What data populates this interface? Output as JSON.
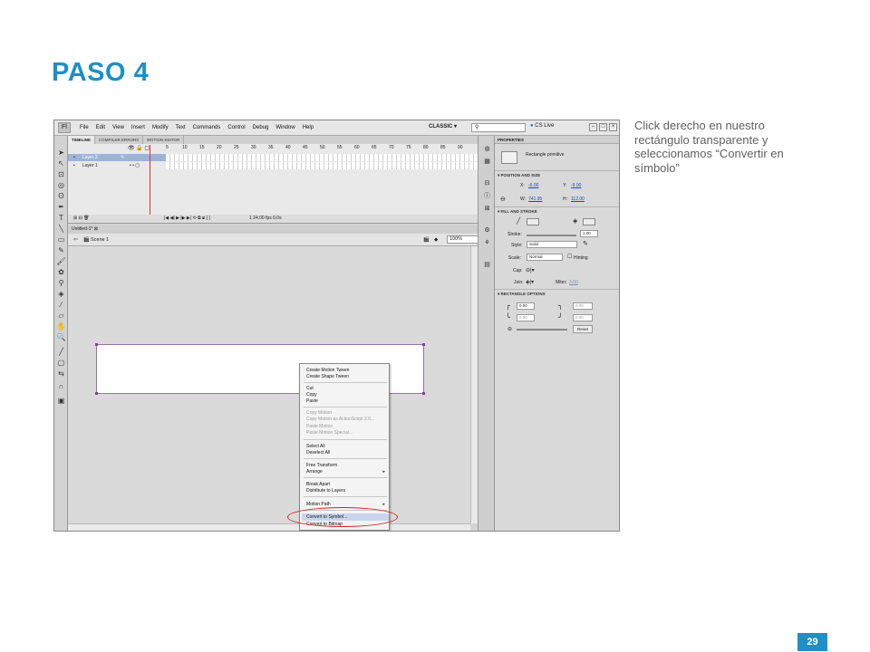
{
  "slide": {
    "title": "PASO 4",
    "caption": "Click derecho en nuestro rectángulo transparente  y seleccionamos “Convertir en símbolo”",
    "page_number": "29",
    "accent_color": "#1f8fc6"
  },
  "app": {
    "logo": "Fl",
    "menus": [
      "File",
      "Edit",
      "View",
      "Insert",
      "Modify",
      "Text",
      "Commands",
      "Control",
      "Debug",
      "Window",
      "Help"
    ],
    "workspace": "CLASSIC ▾",
    "search_placeholder": "",
    "cs_live": "CS Live",
    "timeline": {
      "tabs": [
        "TIMELINE",
        "COMPILER ERRORS",
        "MOTION EDITOR"
      ],
      "frame_numbers": [
        "5",
        "10",
        "15",
        "20",
        "25",
        "30",
        "35",
        "40",
        "45",
        "50",
        "55",
        "60",
        "65",
        "70",
        "75",
        "80",
        "85",
        "90"
      ],
      "layers": [
        "Layer 2",
        "Layer 1"
      ],
      "status": "1   24.00 fps   0.0s"
    },
    "document": {
      "tab": "Untitled-1* ⊠",
      "scene": "Scene 1",
      "zoom": "100%"
    },
    "context_menu": {
      "items": [
        {
          "label": "Create Motion Tween",
          "dim": false
        },
        {
          "label": "Create Shape Tween",
          "dim": false
        },
        {
          "label": "Cut",
          "dim": false
        },
        {
          "label": "Copy",
          "dim": false
        },
        {
          "label": "Paste",
          "dim": false
        },
        {
          "label": "Copy Motion",
          "dim": true
        },
        {
          "label": "Copy Motion as ActionScript 3.0...",
          "dim": true
        },
        {
          "label": "Paste Motion",
          "dim": true
        },
        {
          "label": "Paste Motion Special...",
          "dim": true
        },
        {
          "label": "Select All",
          "dim": false
        },
        {
          "label": "Deselect All",
          "dim": false
        },
        {
          "label": "Free Transform",
          "dim": false
        },
        {
          "label": "Arrange",
          "dim": false
        },
        {
          "label": "Break Apart",
          "dim": false
        },
        {
          "label": "Distribute to Layers",
          "dim": false
        },
        {
          "label": "Motion Path",
          "dim": false
        },
        {
          "label": "Convert to Symbol...",
          "dim": false
        },
        {
          "label": "Convert to Bitmap",
          "dim": false
        }
      ],
      "highlighted": "Convert to Symbol..."
    },
    "properties": {
      "tab": "PROPERTIES",
      "object_type": "Rectangle primitive",
      "position_size_header": "▾ POSITION AND SIZE",
      "x_label": "X:",
      "x_value": "-6.00",
      "y_label": "Y:",
      "y_value": "-9.00",
      "w_label": "W:",
      "w_value": "741.95",
      "h_label": "H:",
      "h_value": "112.00",
      "fill_stroke_header": "▾ FILL AND STROKE",
      "stroke_label": "Stroke:",
      "stroke_value": "1.00",
      "style_label": "Style:",
      "style_value": "Solid",
      "scale_label": "Scale:",
      "scale_value": "Normal",
      "hinting_label": "Hinting",
      "cap_label": "Cap:",
      "join_label": "Join:",
      "miter_label": "Miter:",
      "miter_value": "3.00",
      "rect_options_header": "▾ RECTANGLE OPTIONS",
      "corner_tl": "0.00",
      "corner_tr": "0.00",
      "corner_bl": "0.00",
      "corner_br": "0.00",
      "reset_label": "Reset"
    }
  }
}
